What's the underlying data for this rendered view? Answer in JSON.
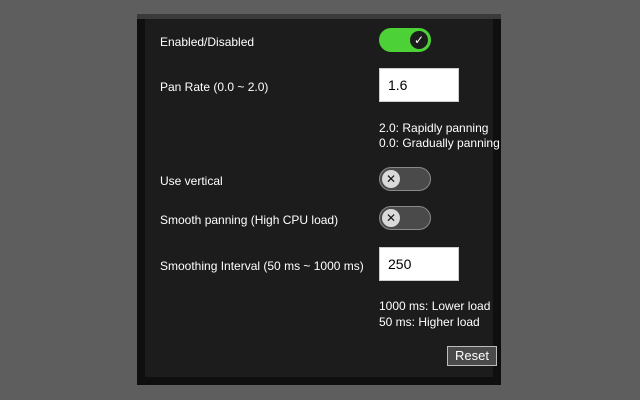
{
  "settings": {
    "enabled": {
      "label": "Enabled/Disabled",
      "state": "on",
      "knob_glyph": "✓",
      "color_on": "#4cd137"
    },
    "pan_rate": {
      "label": "Pan Rate (0.0 ~ 2.0)",
      "value": "1.6",
      "hint_1": "2.0: Rapidly panning",
      "hint_2": "0.0: Gradually panning"
    },
    "use_vertical": {
      "label": "Use vertical",
      "state": "off",
      "knob_glyph": "✕"
    },
    "smooth_panning": {
      "label": "Smooth panning (High CPU load)",
      "state": "off",
      "knob_glyph": "✕"
    },
    "smoothing_interval": {
      "label": "Smoothing Interval (50 ms ~ 1000 ms)",
      "value": "250",
      "hint_1": "1000 ms: Lower load",
      "hint_2": "50 ms: Higher load"
    }
  },
  "buttons": {
    "reset_label": "Reset"
  }
}
